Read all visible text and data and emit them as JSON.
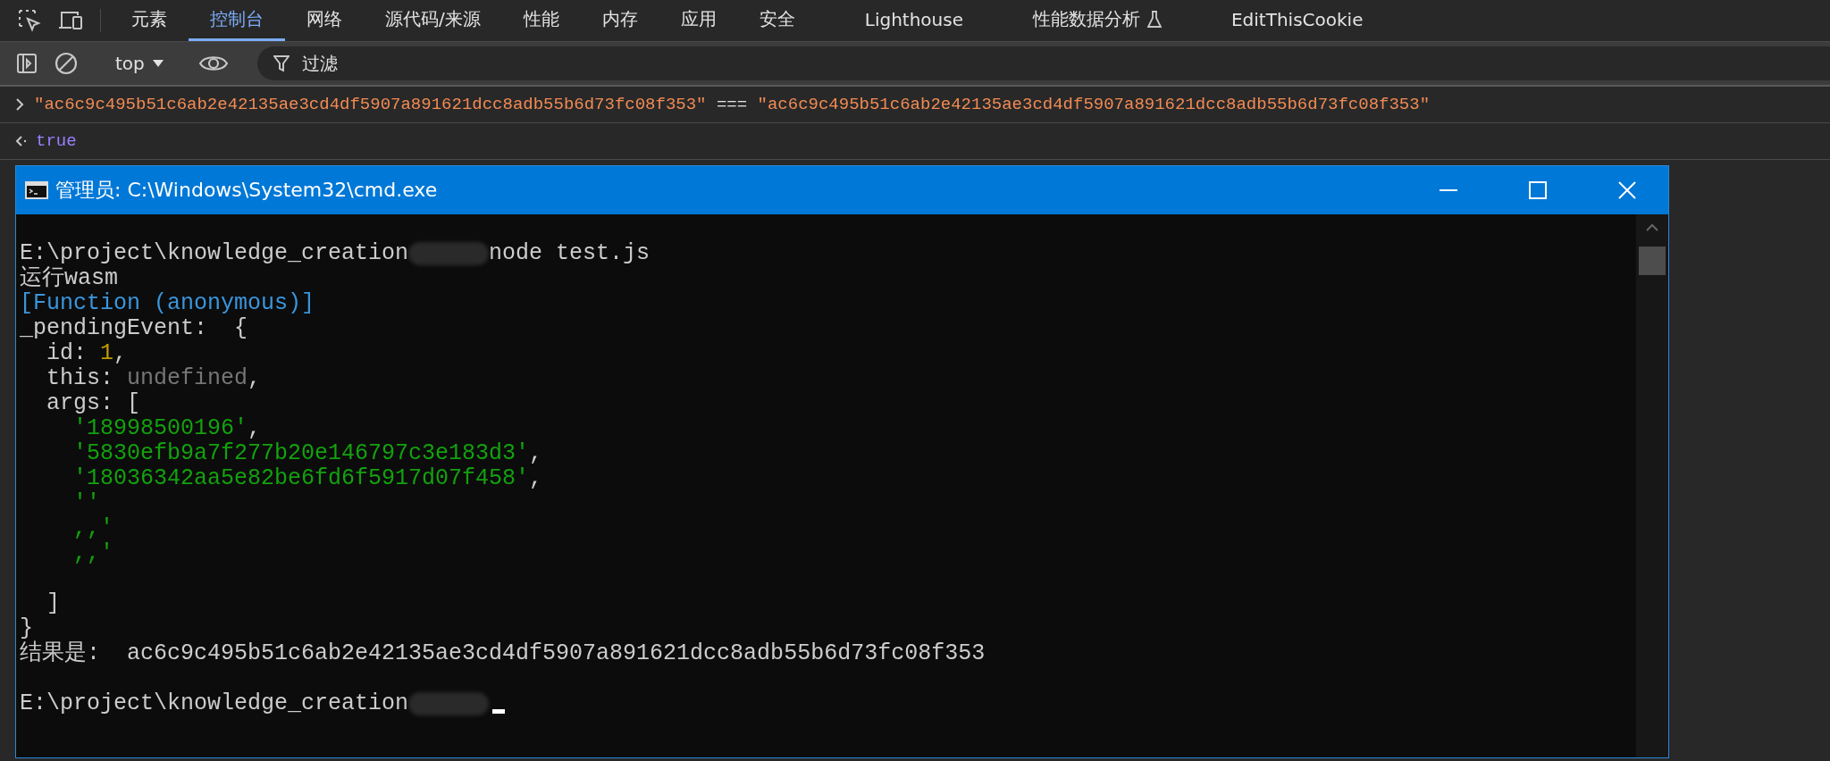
{
  "devtools": {
    "tabs": [
      {
        "label": "元素",
        "selected": false
      },
      {
        "label": "控制台",
        "selected": true
      },
      {
        "label": "网络",
        "selected": false
      },
      {
        "label": "源代码/来源",
        "selected": false
      },
      {
        "label": "性能",
        "selected": false
      },
      {
        "label": "内存",
        "selected": false
      },
      {
        "label": "应用",
        "selected": false
      },
      {
        "label": "安全",
        "selected": false
      },
      {
        "label": "Lighthouse",
        "selected": false
      },
      {
        "label": "性能数据分析",
        "selected": false,
        "experimental": true
      },
      {
        "label": "EditThisCookie",
        "selected": false
      }
    ],
    "toolbar": {
      "context": "top",
      "filter_placeholder": "过滤"
    },
    "console": [
      {
        "kind": "input",
        "parts": [
          {
            "kind": "string",
            "text": "\"ac6c9c495b51c6ab2e42135ae3cd4df5907a891621dcc8adb55b6d73fc08f353\""
          },
          {
            "kind": "operator",
            "text": " === "
          },
          {
            "kind": "string",
            "text": "\"ac6c9c495b51c6ab2e42135ae3cd4df5907a891621dcc8adb55b6d73fc08f353\""
          }
        ]
      },
      {
        "kind": "result",
        "parts": [
          {
            "kind": "boolean",
            "text": "true"
          }
        ]
      }
    ]
  },
  "cmd": {
    "title": "管理员: C:\\Windows\\System32\\cmd.exe",
    "lines": [
      {
        "kind": "blank"
      },
      {
        "kind": "text",
        "parts": [
          {
            "kind": "plain",
            "text": "E:\\project\\knowledge_creation"
          },
          {
            "kind": "redacted"
          },
          {
            "kind": "plain",
            "text": "node test.js"
          }
        ]
      },
      {
        "kind": "text",
        "parts": [
          {
            "kind": "plain",
            "text": "运行wasm"
          }
        ]
      },
      {
        "kind": "text",
        "parts": [
          {
            "kind": "special",
            "text": "[Function (anonymous)]"
          }
        ]
      },
      {
        "kind": "text",
        "parts": [
          {
            "kind": "plain",
            "text": "_pendingEvent:  {"
          }
        ]
      },
      {
        "kind": "text",
        "parts": [
          {
            "kind": "plain",
            "text": "  id: "
          },
          {
            "kind": "number",
            "text": "1"
          },
          {
            "kind": "plain",
            "text": ","
          }
        ]
      },
      {
        "kind": "text",
        "parts": [
          {
            "kind": "plain",
            "text": "  this: "
          },
          {
            "kind": "undefined",
            "text": "undefined"
          },
          {
            "kind": "plain",
            "text": ","
          }
        ]
      },
      {
        "kind": "text",
        "parts": [
          {
            "kind": "plain",
            "text": "  args: ["
          }
        ]
      },
      {
        "kind": "text",
        "parts": [
          {
            "kind": "string",
            "text": "    '18998500196'"
          },
          {
            "kind": "plain",
            "text": ","
          }
        ]
      },
      {
        "kind": "text",
        "parts": [
          {
            "kind": "string",
            "text": "    '5830efb9a7f277b20e146797c3e183d3'"
          },
          {
            "kind": "plain",
            "text": ","
          }
        ]
      },
      {
        "kind": "text",
        "parts": [
          {
            "kind": "string",
            "text": "    '18036342aa5e82be6fd6f5917d07f458'"
          },
          {
            "kind": "plain",
            "text": ","
          }
        ]
      },
      {
        "kind": "text",
        "parts": [
          {
            "kind": "string",
            "text": "    ''"
          }
        ]
      },
      {
        "kind": "text",
        "parts": [
          {
            "kind": "string",
            "text": "    ,,'"
          }
        ]
      },
      {
        "kind": "text",
        "parts": [
          {
            "kind": "string",
            "text": "    ,,'"
          }
        ]
      },
      {
        "kind": "blank"
      },
      {
        "kind": "text",
        "parts": [
          {
            "kind": "plain",
            "text": "  ]"
          }
        ]
      },
      {
        "kind": "text",
        "parts": [
          {
            "kind": "plain",
            "text": "}"
          }
        ]
      },
      {
        "kind": "text",
        "parts": [
          {
            "kind": "plain",
            "text": "结果是:  ac6c9c495b51c6ab2e42135ae3cd4df5907a891621dcc8adb55b6d73fc08f353"
          }
        ]
      },
      {
        "kind": "blank"
      },
      {
        "kind": "text",
        "parts": [
          {
            "kind": "plain",
            "text": "E:\\project\\knowledge_creation"
          },
          {
            "kind": "redacted"
          },
          {
            "kind": "cursor"
          }
        ]
      }
    ]
  }
}
